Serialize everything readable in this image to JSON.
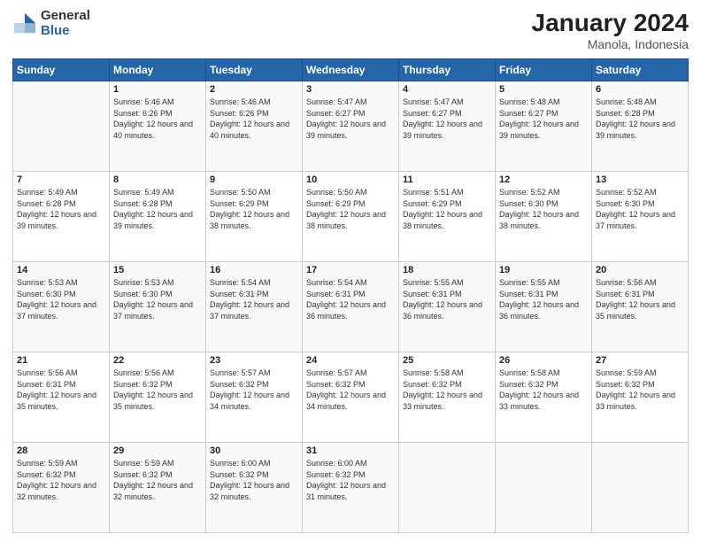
{
  "header": {
    "logo_general": "General",
    "logo_blue": "Blue",
    "month_title": "January 2024",
    "location": "Manola, Indonesia"
  },
  "days_of_week": [
    "Sunday",
    "Monday",
    "Tuesday",
    "Wednesday",
    "Thursday",
    "Friday",
    "Saturday"
  ],
  "weeks": [
    [
      {
        "day": "",
        "sunrise": "",
        "sunset": "",
        "daylight": ""
      },
      {
        "day": "1",
        "sunrise": "5:46 AM",
        "sunset": "6:26 PM",
        "daylight": "12 hours and 40 minutes."
      },
      {
        "day": "2",
        "sunrise": "5:46 AM",
        "sunset": "6:26 PM",
        "daylight": "12 hours and 40 minutes."
      },
      {
        "day": "3",
        "sunrise": "5:47 AM",
        "sunset": "6:27 PM",
        "daylight": "12 hours and 39 minutes."
      },
      {
        "day": "4",
        "sunrise": "5:47 AM",
        "sunset": "6:27 PM",
        "daylight": "12 hours and 39 minutes."
      },
      {
        "day": "5",
        "sunrise": "5:48 AM",
        "sunset": "6:27 PM",
        "daylight": "12 hours and 39 minutes."
      },
      {
        "day": "6",
        "sunrise": "5:48 AM",
        "sunset": "6:28 PM",
        "daylight": "12 hours and 39 minutes."
      }
    ],
    [
      {
        "day": "7",
        "sunrise": "5:49 AM",
        "sunset": "6:28 PM",
        "daylight": "12 hours and 39 minutes."
      },
      {
        "day": "8",
        "sunrise": "5:49 AM",
        "sunset": "6:28 PM",
        "daylight": "12 hours and 39 minutes."
      },
      {
        "day": "9",
        "sunrise": "5:50 AM",
        "sunset": "6:29 PM",
        "daylight": "12 hours and 38 minutes."
      },
      {
        "day": "10",
        "sunrise": "5:50 AM",
        "sunset": "6:29 PM",
        "daylight": "12 hours and 38 minutes."
      },
      {
        "day": "11",
        "sunrise": "5:51 AM",
        "sunset": "6:29 PM",
        "daylight": "12 hours and 38 minutes."
      },
      {
        "day": "12",
        "sunrise": "5:52 AM",
        "sunset": "6:30 PM",
        "daylight": "12 hours and 38 minutes."
      },
      {
        "day": "13",
        "sunrise": "5:52 AM",
        "sunset": "6:30 PM",
        "daylight": "12 hours and 37 minutes."
      }
    ],
    [
      {
        "day": "14",
        "sunrise": "5:53 AM",
        "sunset": "6:30 PM",
        "daylight": "12 hours and 37 minutes."
      },
      {
        "day": "15",
        "sunrise": "5:53 AM",
        "sunset": "6:30 PM",
        "daylight": "12 hours and 37 minutes."
      },
      {
        "day": "16",
        "sunrise": "5:54 AM",
        "sunset": "6:31 PM",
        "daylight": "12 hours and 37 minutes."
      },
      {
        "day": "17",
        "sunrise": "5:54 AM",
        "sunset": "6:31 PM",
        "daylight": "12 hours and 36 minutes."
      },
      {
        "day": "18",
        "sunrise": "5:55 AM",
        "sunset": "6:31 PM",
        "daylight": "12 hours and 36 minutes."
      },
      {
        "day": "19",
        "sunrise": "5:55 AM",
        "sunset": "6:31 PM",
        "daylight": "12 hours and 36 minutes."
      },
      {
        "day": "20",
        "sunrise": "5:56 AM",
        "sunset": "6:31 PM",
        "daylight": "12 hours and 35 minutes."
      }
    ],
    [
      {
        "day": "21",
        "sunrise": "5:56 AM",
        "sunset": "6:31 PM",
        "daylight": "12 hours and 35 minutes."
      },
      {
        "day": "22",
        "sunrise": "5:56 AM",
        "sunset": "6:32 PM",
        "daylight": "12 hours and 35 minutes."
      },
      {
        "day": "23",
        "sunrise": "5:57 AM",
        "sunset": "6:32 PM",
        "daylight": "12 hours and 34 minutes."
      },
      {
        "day": "24",
        "sunrise": "5:57 AM",
        "sunset": "6:32 PM",
        "daylight": "12 hours and 34 minutes."
      },
      {
        "day": "25",
        "sunrise": "5:58 AM",
        "sunset": "6:32 PM",
        "daylight": "12 hours and 33 minutes."
      },
      {
        "day": "26",
        "sunrise": "5:58 AM",
        "sunset": "6:32 PM",
        "daylight": "12 hours and 33 minutes."
      },
      {
        "day": "27",
        "sunrise": "5:59 AM",
        "sunset": "6:32 PM",
        "daylight": "12 hours and 33 minutes."
      }
    ],
    [
      {
        "day": "28",
        "sunrise": "5:59 AM",
        "sunset": "6:32 PM",
        "daylight": "12 hours and 32 minutes."
      },
      {
        "day": "29",
        "sunrise": "5:59 AM",
        "sunset": "6:32 PM",
        "daylight": "12 hours and 32 minutes."
      },
      {
        "day": "30",
        "sunrise": "6:00 AM",
        "sunset": "6:32 PM",
        "daylight": "12 hours and 32 minutes."
      },
      {
        "day": "31",
        "sunrise": "6:00 AM",
        "sunset": "6:32 PM",
        "daylight": "12 hours and 31 minutes."
      },
      {
        "day": "",
        "sunrise": "",
        "sunset": "",
        "daylight": ""
      },
      {
        "day": "",
        "sunrise": "",
        "sunset": "",
        "daylight": ""
      },
      {
        "day": "",
        "sunrise": "",
        "sunset": "",
        "daylight": ""
      }
    ]
  ],
  "labels": {
    "sunrise_prefix": "Sunrise:",
    "sunset_prefix": "Sunset:",
    "daylight_prefix": "Daylight:"
  }
}
